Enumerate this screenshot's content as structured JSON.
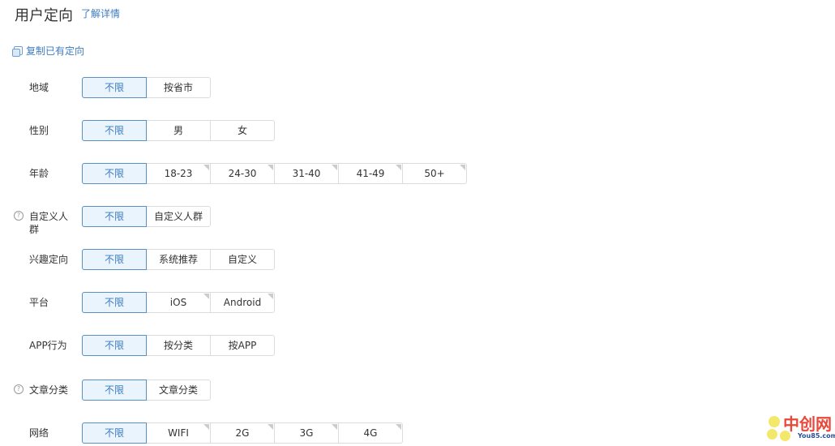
{
  "header": {
    "title": "用户定向",
    "detail_link": "了解详情"
  },
  "copy_link": {
    "label": "复制已有定向",
    "icon": "copy-icon"
  },
  "rows": [
    {
      "label": "地域",
      "help": false,
      "options": [
        {
          "label": "不限",
          "selected": true
        },
        {
          "label": "按省市"
        }
      ]
    },
    {
      "label": "性别",
      "help": false,
      "options": [
        {
          "label": "不限",
          "selected": true
        },
        {
          "label": "男"
        },
        {
          "label": "女"
        }
      ]
    },
    {
      "label": "年龄",
      "help": false,
      "options": [
        {
          "label": "不限",
          "selected": true
        },
        {
          "label": "18-23",
          "multi": true
        },
        {
          "label": "24-30",
          "multi": true
        },
        {
          "label": "31-40",
          "multi": true
        },
        {
          "label": "41-49",
          "multi": true
        },
        {
          "label": "50+",
          "multi": true
        }
      ]
    },
    {
      "label": "自定义人群",
      "help": true,
      "options": [
        {
          "label": "不限",
          "selected": true
        },
        {
          "label": "自定义人群"
        }
      ]
    },
    {
      "label": "兴趣定向",
      "help": false,
      "options": [
        {
          "label": "不限",
          "selected": true
        },
        {
          "label": "系统推荐"
        },
        {
          "label": "自定义"
        }
      ]
    },
    {
      "label": "平台",
      "help": false,
      "options": [
        {
          "label": "不限",
          "selected": true
        },
        {
          "label": "iOS",
          "multi": true
        },
        {
          "label": "Android",
          "multi": true
        }
      ]
    },
    {
      "label": "APP行为",
      "help": false,
      "options": [
        {
          "label": "不限",
          "selected": true
        },
        {
          "label": "按分类"
        },
        {
          "label": "按APP"
        }
      ]
    },
    {
      "label": "文章分类",
      "help": true,
      "options": [
        {
          "label": "不限",
          "selected": true
        },
        {
          "label": "文章分类"
        }
      ]
    },
    {
      "label": "网络",
      "help": false,
      "options": [
        {
          "label": "不限",
          "selected": true
        },
        {
          "label": "WIFI",
          "multi": true
        },
        {
          "label": "2G",
          "multi": true
        },
        {
          "label": "3G",
          "multi": true
        },
        {
          "label": "4G",
          "multi": true
        }
      ]
    }
  ],
  "help_glyph": "?",
  "watermark": {
    "cn": "中创网",
    "en": "You85.com"
  },
  "colors": {
    "accent": "#3d7bbf",
    "selected_bg": "#eaf4fd"
  }
}
